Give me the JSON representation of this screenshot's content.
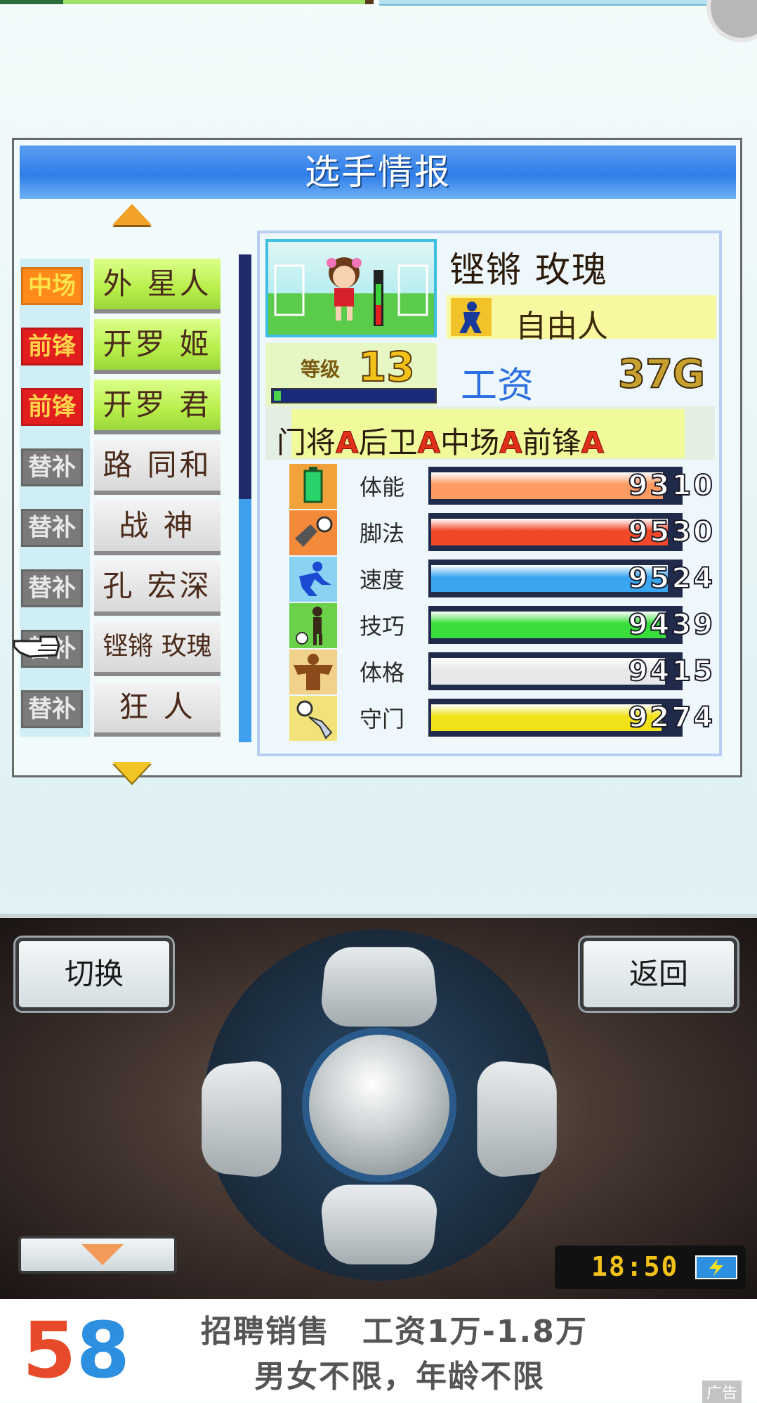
{
  "screen": {
    "title": "选手情报"
  },
  "roster": [
    {
      "position": "中场",
      "name": "外 星人",
      "status": "active"
    },
    {
      "position": "前锋",
      "name": "开罗 姬",
      "status": "active"
    },
    {
      "position": "前锋",
      "name": "开罗 君",
      "status": "active"
    },
    {
      "position": "替补",
      "name": "路 同和",
      "status": "bench"
    },
    {
      "position": "替补",
      "name": "战 神",
      "status": "bench"
    },
    {
      "position": "替补",
      "name": "孔 宏深",
      "status": "bench"
    },
    {
      "position": "替补",
      "name": "铿锵 玫瑰",
      "status": "bench",
      "selected": true
    },
    {
      "position": "替补",
      "name": "狂 人",
      "status": "bench"
    }
  ],
  "player": {
    "name": "铿锵 玫瑰",
    "status": "自由人",
    "level_label": "等级",
    "level": "13",
    "salary_label": "工资",
    "salary": "37G",
    "aptitude": {
      "gk_label": "门将",
      "gk": "A",
      "df_label": "后卫",
      "df": "A",
      "mf_label": "中场",
      "mf": "A",
      "fw_label": "前锋",
      "fw": "A"
    },
    "stats": [
      {
        "label": "体能",
        "value": "9310",
        "icon": "stamina-icon",
        "color": "#ff9a62"
      },
      {
        "label": "脚法",
        "value": "9530",
        "icon": "kick-icon",
        "color": "#f2482a"
      },
      {
        "label": "速度",
        "value": "9524",
        "icon": "speed-icon",
        "color": "#3aa6ef"
      },
      {
        "label": "技巧",
        "value": "9439",
        "icon": "technique-icon",
        "color": "#3ade3a"
      },
      {
        "label": "体格",
        "value": "9415",
        "icon": "physique-icon",
        "color": "#e8e8e8"
      },
      {
        "label": "守门",
        "value": "9274",
        "icon": "goalkeeping-icon",
        "color": "#f2e21a"
      }
    ]
  },
  "controls": {
    "switch_label": "切换",
    "back_label": "返回",
    "clock": "18:50"
  },
  "ad": {
    "logo_5": "5",
    "logo_8": "8",
    "line1": "招聘销售　工资1万-1.8万",
    "line2": "男女不限，年龄不限",
    "tag": "广告"
  }
}
